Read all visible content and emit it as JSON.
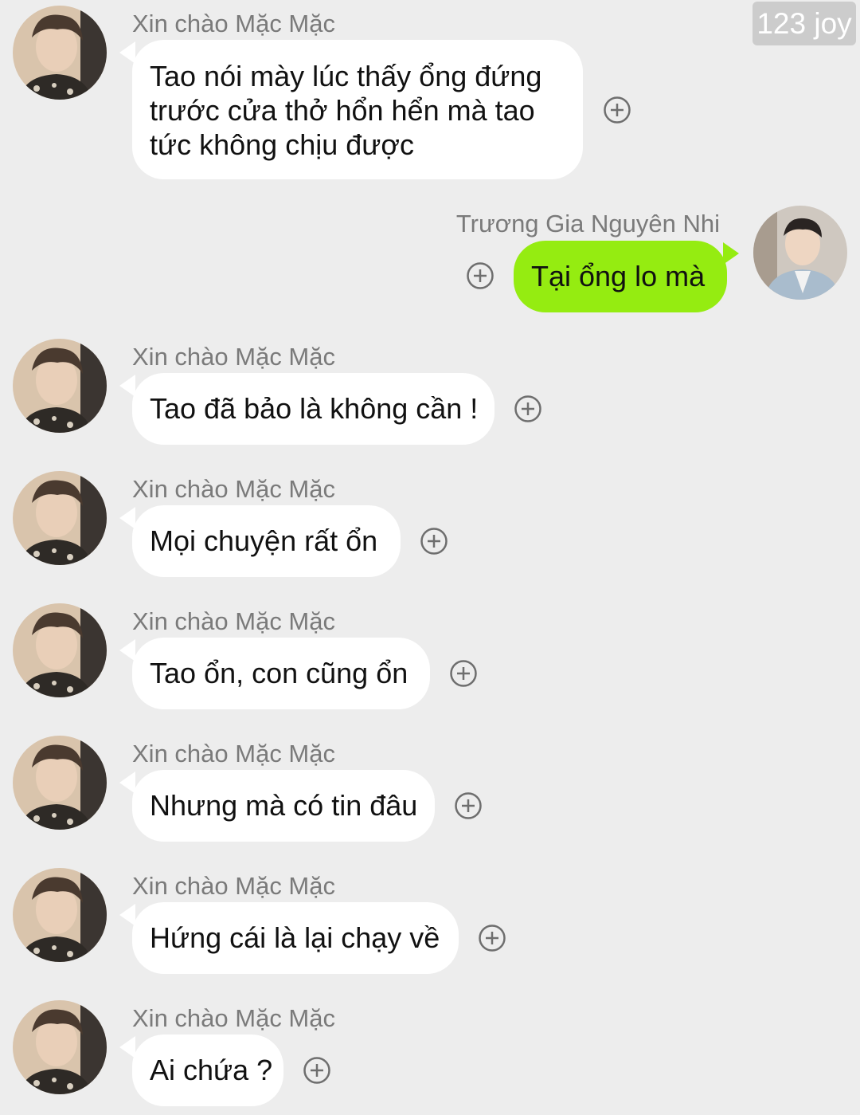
{
  "watermark": "123 joy",
  "messages": [
    {
      "sender": "Xin chào Mặc Mặc",
      "text": "Tao nói mày lúc thấy ổng đứng trước cửa thở hổn hển mà tao tức không chịu được",
      "direction": "incoming",
      "avatar": "boy-avatar-icon"
    },
    {
      "sender": "Trương Gia Nguyên Nhi",
      "text": "Tại ổng lo mà",
      "direction": "outgoing",
      "avatar": "man-avatar-icon"
    },
    {
      "sender": "Xin chào Mặc Mặc",
      "text": "Tao đã bảo là không cần !",
      "direction": "incoming",
      "avatar": "boy-avatar-icon"
    },
    {
      "sender": "Xin chào Mặc Mặc",
      "text": "Mọi chuyện rất ổn",
      "direction": "incoming",
      "avatar": "boy-avatar-icon"
    },
    {
      "sender": "Xin chào Mặc Mặc",
      "text": "Tao ổn, con cũng ổn",
      "direction": "incoming",
      "avatar": "boy-avatar-icon"
    },
    {
      "sender": "Xin chào Mặc Mặc",
      "text": "Nhưng mà có tin đâu",
      "direction": "incoming",
      "avatar": "boy-avatar-icon"
    },
    {
      "sender": "Xin chào Mặc Mặc",
      "text": "Hứng cái là lại chạy về",
      "direction": "incoming",
      "avatar": "boy-avatar-icon"
    },
    {
      "sender": "Xin chào Mặc Mặc",
      "text": "Ai chứa ?",
      "direction": "incoming",
      "avatar": "boy-avatar-icon"
    }
  ],
  "colors": {
    "background": "#ededed",
    "incoming_bubble": "#ffffff",
    "outgoing_bubble": "#95ec11",
    "sender_text": "#7a7a7a",
    "message_text": "#111111"
  },
  "icons": {
    "react": "plus-circle-icon"
  }
}
